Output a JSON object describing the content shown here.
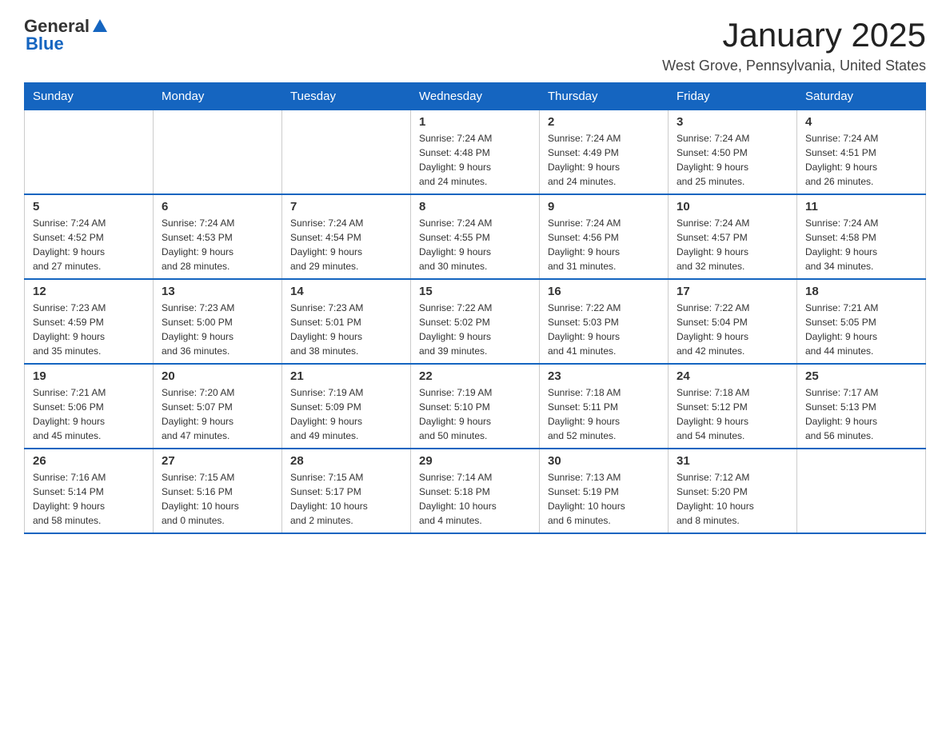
{
  "header": {
    "logo_general": "General",
    "logo_blue": "Blue",
    "month_title": "January 2025",
    "location": "West Grove, Pennsylvania, United States"
  },
  "weekdays": [
    "Sunday",
    "Monday",
    "Tuesday",
    "Wednesday",
    "Thursday",
    "Friday",
    "Saturday"
  ],
  "weeks": [
    [
      {
        "day": "",
        "info": ""
      },
      {
        "day": "",
        "info": ""
      },
      {
        "day": "",
        "info": ""
      },
      {
        "day": "1",
        "info": "Sunrise: 7:24 AM\nSunset: 4:48 PM\nDaylight: 9 hours\nand 24 minutes."
      },
      {
        "day": "2",
        "info": "Sunrise: 7:24 AM\nSunset: 4:49 PM\nDaylight: 9 hours\nand 24 minutes."
      },
      {
        "day": "3",
        "info": "Sunrise: 7:24 AM\nSunset: 4:50 PM\nDaylight: 9 hours\nand 25 minutes."
      },
      {
        "day": "4",
        "info": "Sunrise: 7:24 AM\nSunset: 4:51 PM\nDaylight: 9 hours\nand 26 minutes."
      }
    ],
    [
      {
        "day": "5",
        "info": "Sunrise: 7:24 AM\nSunset: 4:52 PM\nDaylight: 9 hours\nand 27 minutes."
      },
      {
        "day": "6",
        "info": "Sunrise: 7:24 AM\nSunset: 4:53 PM\nDaylight: 9 hours\nand 28 minutes."
      },
      {
        "day": "7",
        "info": "Sunrise: 7:24 AM\nSunset: 4:54 PM\nDaylight: 9 hours\nand 29 minutes."
      },
      {
        "day": "8",
        "info": "Sunrise: 7:24 AM\nSunset: 4:55 PM\nDaylight: 9 hours\nand 30 minutes."
      },
      {
        "day": "9",
        "info": "Sunrise: 7:24 AM\nSunset: 4:56 PM\nDaylight: 9 hours\nand 31 minutes."
      },
      {
        "day": "10",
        "info": "Sunrise: 7:24 AM\nSunset: 4:57 PM\nDaylight: 9 hours\nand 32 minutes."
      },
      {
        "day": "11",
        "info": "Sunrise: 7:24 AM\nSunset: 4:58 PM\nDaylight: 9 hours\nand 34 minutes."
      }
    ],
    [
      {
        "day": "12",
        "info": "Sunrise: 7:23 AM\nSunset: 4:59 PM\nDaylight: 9 hours\nand 35 minutes."
      },
      {
        "day": "13",
        "info": "Sunrise: 7:23 AM\nSunset: 5:00 PM\nDaylight: 9 hours\nand 36 minutes."
      },
      {
        "day": "14",
        "info": "Sunrise: 7:23 AM\nSunset: 5:01 PM\nDaylight: 9 hours\nand 38 minutes."
      },
      {
        "day": "15",
        "info": "Sunrise: 7:22 AM\nSunset: 5:02 PM\nDaylight: 9 hours\nand 39 minutes."
      },
      {
        "day": "16",
        "info": "Sunrise: 7:22 AM\nSunset: 5:03 PM\nDaylight: 9 hours\nand 41 minutes."
      },
      {
        "day": "17",
        "info": "Sunrise: 7:22 AM\nSunset: 5:04 PM\nDaylight: 9 hours\nand 42 minutes."
      },
      {
        "day": "18",
        "info": "Sunrise: 7:21 AM\nSunset: 5:05 PM\nDaylight: 9 hours\nand 44 minutes."
      }
    ],
    [
      {
        "day": "19",
        "info": "Sunrise: 7:21 AM\nSunset: 5:06 PM\nDaylight: 9 hours\nand 45 minutes."
      },
      {
        "day": "20",
        "info": "Sunrise: 7:20 AM\nSunset: 5:07 PM\nDaylight: 9 hours\nand 47 minutes."
      },
      {
        "day": "21",
        "info": "Sunrise: 7:19 AM\nSunset: 5:09 PM\nDaylight: 9 hours\nand 49 minutes."
      },
      {
        "day": "22",
        "info": "Sunrise: 7:19 AM\nSunset: 5:10 PM\nDaylight: 9 hours\nand 50 minutes."
      },
      {
        "day": "23",
        "info": "Sunrise: 7:18 AM\nSunset: 5:11 PM\nDaylight: 9 hours\nand 52 minutes."
      },
      {
        "day": "24",
        "info": "Sunrise: 7:18 AM\nSunset: 5:12 PM\nDaylight: 9 hours\nand 54 minutes."
      },
      {
        "day": "25",
        "info": "Sunrise: 7:17 AM\nSunset: 5:13 PM\nDaylight: 9 hours\nand 56 minutes."
      }
    ],
    [
      {
        "day": "26",
        "info": "Sunrise: 7:16 AM\nSunset: 5:14 PM\nDaylight: 9 hours\nand 58 minutes."
      },
      {
        "day": "27",
        "info": "Sunrise: 7:15 AM\nSunset: 5:16 PM\nDaylight: 10 hours\nand 0 minutes."
      },
      {
        "day": "28",
        "info": "Sunrise: 7:15 AM\nSunset: 5:17 PM\nDaylight: 10 hours\nand 2 minutes."
      },
      {
        "day": "29",
        "info": "Sunrise: 7:14 AM\nSunset: 5:18 PM\nDaylight: 10 hours\nand 4 minutes."
      },
      {
        "day": "30",
        "info": "Sunrise: 7:13 AM\nSunset: 5:19 PM\nDaylight: 10 hours\nand 6 minutes."
      },
      {
        "day": "31",
        "info": "Sunrise: 7:12 AM\nSunset: 5:20 PM\nDaylight: 10 hours\nand 8 minutes."
      },
      {
        "day": "",
        "info": ""
      }
    ]
  ]
}
